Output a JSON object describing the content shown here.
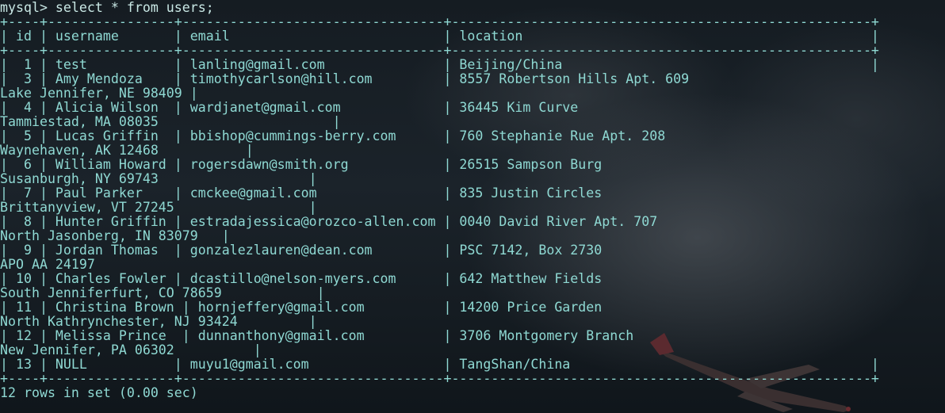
{
  "terminal": {
    "lines": [
      "mysql> select * from users;",
      "+----+----------------+---------------------------------+-----------------------------------------------------+",
      "| id | username       | email                           | location                                            |",
      "+----+----------------+---------------------------------+-----------------------------------------------------+",
      "|  1 | test           | lanling@gmail.com               | Beijing/China                                       |",
      "|  3 | Amy Mendoza    | timothycarlson@hill.com         | 8557 Robertson Hills Apt. 609",
      "Lake Jennifer, NE 98409 |",
      "|  4 | Alicia Wilson  | wardjanet@gmail.com             | 36445 Kim Curve",
      "Tammiestad, MA 08035                      |",
      "|  5 | Lucas Griffin  | bbishop@cummings-berry.com      | 760 Stephanie Rue Apt. 208",
      "Waynehaven, AK 12468           |",
      "|  6 | William Howard | rogersdawn@smith.org            | 26515 Sampson Burg",
      "Susanburgh, NY 69743                   |",
      "|  7 | Paul Parker    | cmckee@gmail.com                | 835 Justin Circles",
      "Brittanyview, VT 27245                 |",
      "|  8 | Hunter Griffin | estradajessica@orozco-allen.com | 0040 David River Apt. 707",
      "North Jasonberg, IN 83079   |",
      "|  9 | Jordan Thomas  | gonzalezlauren@dean.com         | PSC 7142, Box 2730",
      "APO AA 24197",
      "| 10 | Charles Fowler | dcastillo@nelson-myers.com      | 642 Matthew Fields",
      "South Jenniferfurt, CO 78659            |",
      "| 11 | Christina Brown | hornjeffery@gmail.com          | 14200 Price Garden",
      "North Kathrynchester, NJ 93424         |",
      "| 12 | Melissa Prince  | dunnanthony@gmail.com          | 3706 Montgomery Branch",
      "New Jennifer, PA 06302          |",
      "| 13 | NULL           | muyu1@gmail.com                 | TangShan/China                                      |",
      "+----+----------------+---------------------------------+-----------------------------------------------------+",
      "12 rows in set (0.00 sec)"
    ]
  },
  "colors": {
    "text": "#8fd9d3",
    "background": "#141b21"
  },
  "icons": {
    "background_image": "airplane-silhouette-icon"
  }
}
